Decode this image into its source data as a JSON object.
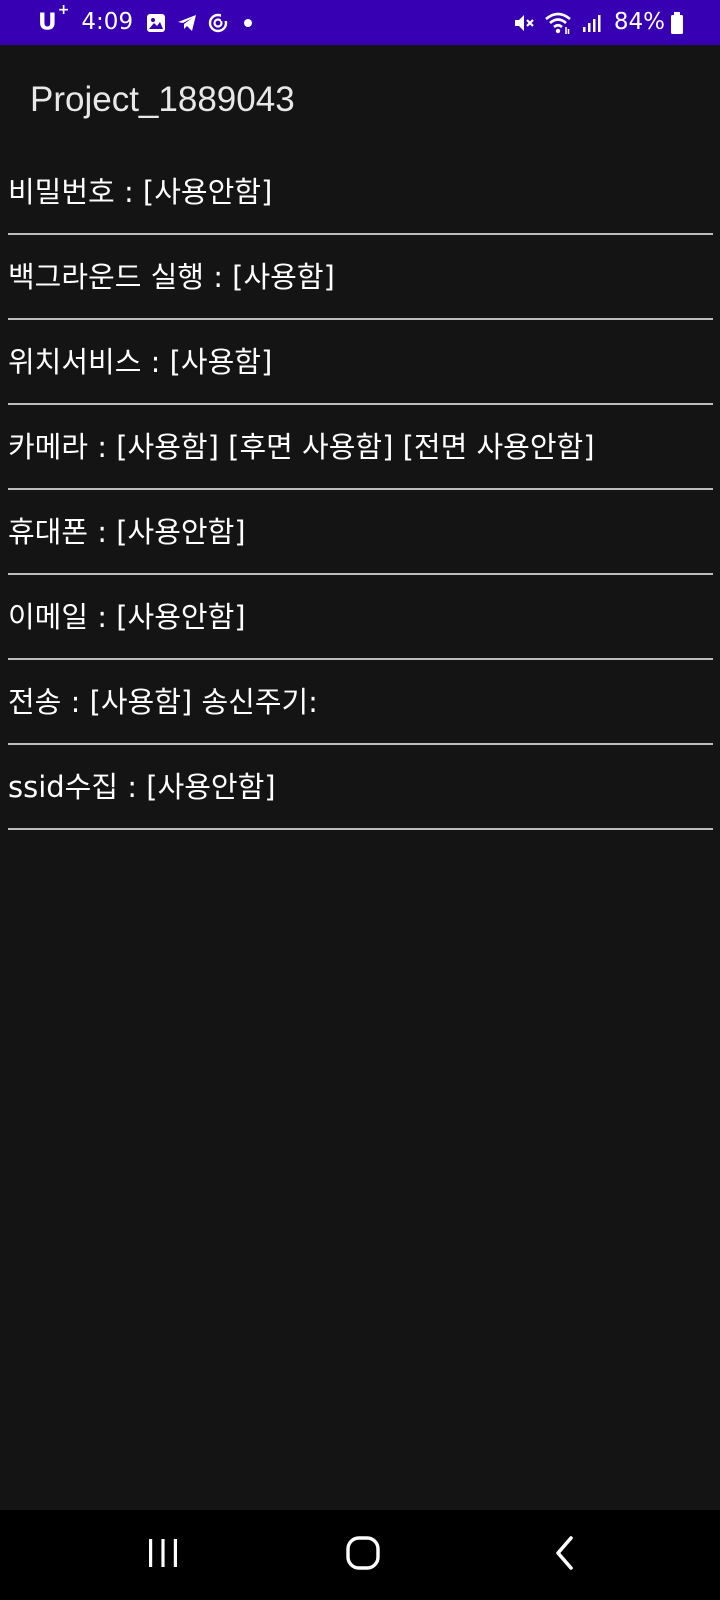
{
  "status_bar": {
    "carrier": "U",
    "carrier_sup": "+",
    "time": "4:09",
    "battery_percent": "84%",
    "icons_left": [
      "gallery-icon",
      "telegram-icon",
      "sync-icon",
      "dot-icon"
    ],
    "icons_right": [
      "mute-icon",
      "wifi-icon",
      "signal-icon",
      "battery-icon"
    ],
    "background_color": "#3700b3"
  },
  "app_bar": {
    "title": "Project_1889043"
  },
  "settings": [
    {
      "text": "비밀번호 : [사용안함]"
    },
    {
      "text": "백그라운드 실행 : [사용함]"
    },
    {
      "text": "위치서비스 : [사용함]"
    },
    {
      "text": "카메라 : [사용함] [후면 사용함] [전면 사용안함]"
    },
    {
      "text": "휴대폰 : [사용안함]"
    },
    {
      "text": "이메일 : [사용안함]"
    },
    {
      "text": "전송 : [사용함] 송신주기:"
    },
    {
      "text": "ssid수집 : [사용안함]"
    }
  ],
  "nav_bar": {
    "buttons": [
      "recents-icon",
      "home-icon",
      "back-icon"
    ]
  }
}
